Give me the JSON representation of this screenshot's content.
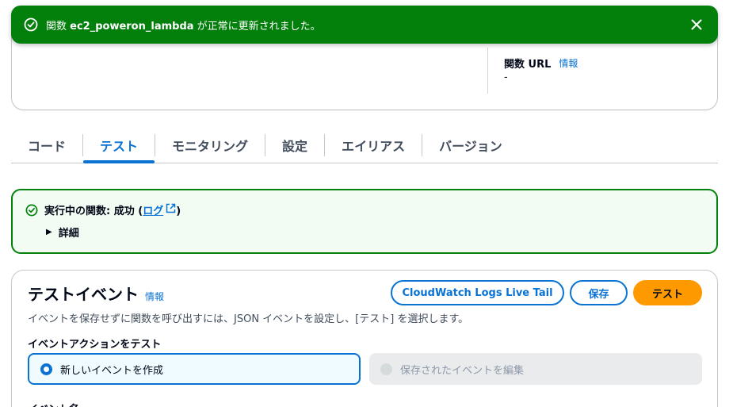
{
  "flash": {
    "prefix": "関数 ",
    "function_name": "ec2_poweron_lambda",
    "suffix": " が正常に更新されました。",
    "close_label": "閉じる"
  },
  "summary": {
    "function_url_label": "関数 URL",
    "function_url_info": "情報",
    "function_url_value": "-"
  },
  "tabs": [
    {
      "label": "コード"
    },
    {
      "label": "テスト"
    },
    {
      "label": "モニタリング"
    },
    {
      "label": "設定"
    },
    {
      "label": "エイリアス"
    },
    {
      "label": "バージョン"
    }
  ],
  "active_tab": "テスト",
  "alert": {
    "status_text": "実行中の関数: 成功 (",
    "log_link": "ログ",
    "status_close": ")",
    "details_label": "詳細"
  },
  "test_event": {
    "title": "テストイベント",
    "info": "情報",
    "cloudwatch_button": "CloudWatch Logs Live Tail",
    "save_button": "保存",
    "test_button": "テスト",
    "description": "イベントを保存せずに関数を呼び出すには、JSON イベントを設定し、[テスト] を選択します。",
    "action_label": "イベントアクションをテスト",
    "option_new": "新しいイベントを作成",
    "option_edit_saved": "保存されたイベントを編集",
    "event_name_label": "イベント名"
  },
  "colors": {
    "success": "#037f0c",
    "link": "#0972d3",
    "primary_button": "#ff9900"
  }
}
